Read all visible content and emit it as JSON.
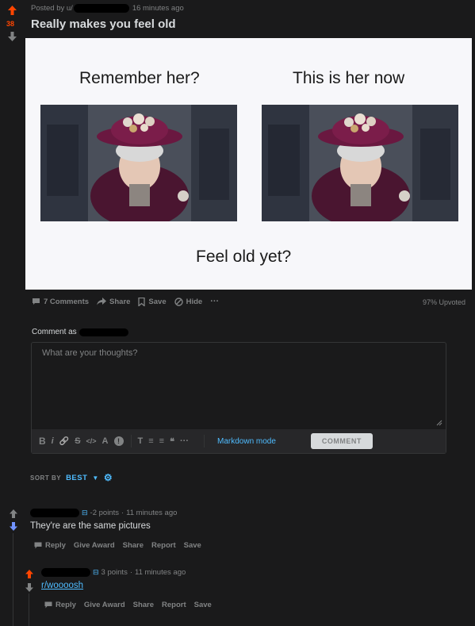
{
  "post": {
    "score": "38",
    "posted_by_prefix": "Posted by u/",
    "time": "16 minutes ago",
    "title": "Really makes you feel old"
  },
  "meme": {
    "caption_left": "Remember her?",
    "caption_right": "This is her now",
    "caption_bottom": "Feel old yet?"
  },
  "actions": {
    "comments": "7 Comments",
    "share": "Share",
    "save": "Save",
    "hide": "Hide",
    "more": "···",
    "upvoted": "97% Upvoted"
  },
  "editor": {
    "comment_as": "Comment as",
    "placeholder": "What are your thoughts?",
    "toolbar": [
      "B",
      "i",
      "🔗",
      "S",
      "</>",
      "A",
      "!",
      "T",
      "≡",
      "≡",
      "❝",
      "···"
    ],
    "markdown_mode": "Markdown mode",
    "comment_button": "COMMENT"
  },
  "sort": {
    "label": "SORT BY",
    "value": "BEST"
  },
  "comments": [
    {
      "points": "-2 points",
      "time": "11 minutes ago",
      "body": "They're are the same pictures",
      "actions": [
        "Reply",
        "Give Award",
        "Share",
        "Report",
        "Save"
      ]
    },
    {
      "points": "3 points",
      "time": "11 minutes ago",
      "body": "r/woooosh",
      "actions": [
        "Reply",
        "Give Award",
        "Share",
        "Report",
        "Save"
      ]
    }
  ],
  "colors": {
    "upvote": "#ff4500",
    "downvote_active": "#7193ff",
    "link": "#4fbcff",
    "background": "#1a1a1b"
  }
}
